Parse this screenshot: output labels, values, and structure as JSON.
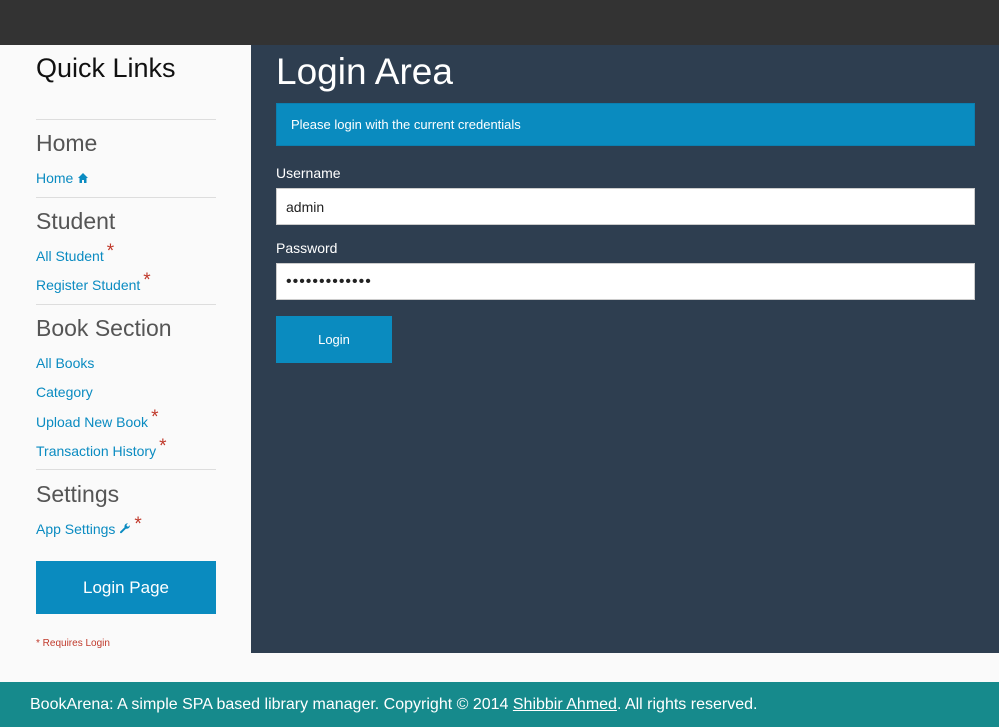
{
  "sidebar": {
    "title": "Quick Links",
    "sections": [
      {
        "heading": "Home",
        "links": [
          {
            "label": "Home",
            "icon": "home-icon",
            "requires_login": false
          }
        ]
      },
      {
        "heading": "Student",
        "links": [
          {
            "label": "All Student",
            "requires_login": true
          },
          {
            "label": "Register Student",
            "requires_login": true
          }
        ]
      },
      {
        "heading": "Book Section",
        "links": [
          {
            "label": "All Books",
            "requires_login": false
          },
          {
            "label": "Category",
            "requires_login": false
          },
          {
            "label": "Upload New Book",
            "requires_login": true
          },
          {
            "label": "Transaction History",
            "requires_login": true
          }
        ]
      },
      {
        "heading": "Settings",
        "links": [
          {
            "label": "App Settings",
            "icon": "wrench-icon",
            "requires_login": true
          }
        ]
      }
    ],
    "required_star": "*",
    "login_page_button": "Login Page",
    "requires_login_note": "* Requires Login"
  },
  "main": {
    "title": "Login Area",
    "alert": "Please login with the current credentials",
    "username_label": "Username",
    "username_value": "admin",
    "password_label": "Password",
    "password_value": "•••••••••••••",
    "login_button": "Login"
  },
  "footer": {
    "text_before": "BookArena: A simple SPA based library manager. Copyright © 2014 ",
    "author_link": "Shibbir Ahmed",
    "text_after": ". All rights reserved."
  },
  "colors": {
    "accent": "#0a8bbf",
    "main_bg": "#2e3e50",
    "footer_bg": "#168a8c",
    "required": "#c0392b"
  }
}
